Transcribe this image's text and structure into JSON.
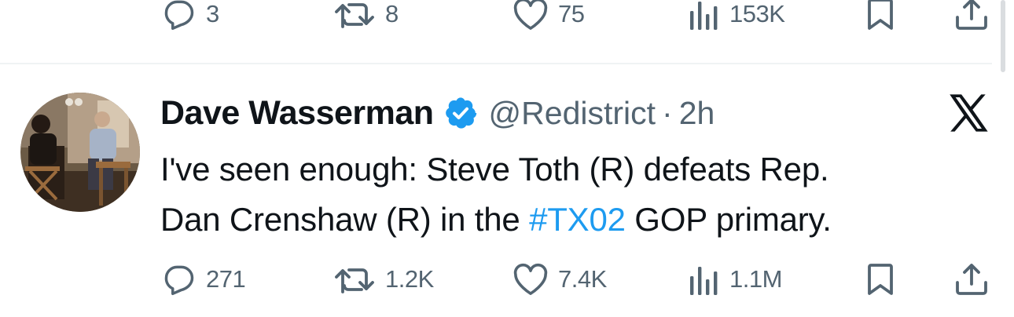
{
  "previous_tweet": {
    "actions": {
      "replies": "3",
      "retweets": "8",
      "likes": "75",
      "views": "153K"
    }
  },
  "tweet": {
    "author": {
      "display_name": "Dave Wasserman",
      "handle": "@Redistrict",
      "verified": true
    },
    "separator": "·",
    "time": "2h",
    "text": {
      "line1": "I've seen enough: Steve Toth (R) defeats Rep.",
      "line2_before": "Dan Crenshaw (R) in the ",
      "hashtag": "#TX02",
      "line2_after": " GOP primary."
    },
    "actions": {
      "replies": "271",
      "retweets": "1.2K",
      "likes": "7.4K",
      "views": "1.1M"
    }
  },
  "icons": {
    "reply": "reply-bubble-icon",
    "retweet": "retweet-arrows-icon",
    "like": "heart-icon",
    "views": "views-bars-icon",
    "bookmark": "bookmark-icon",
    "share": "share-upload-icon",
    "verified": "verified-badge-icon",
    "platform": "x-logo-icon"
  },
  "colors": {
    "text": "#0f1419",
    "secondary": "#536471",
    "accent": "#1d9bf0",
    "divider": "#eff3f4"
  }
}
